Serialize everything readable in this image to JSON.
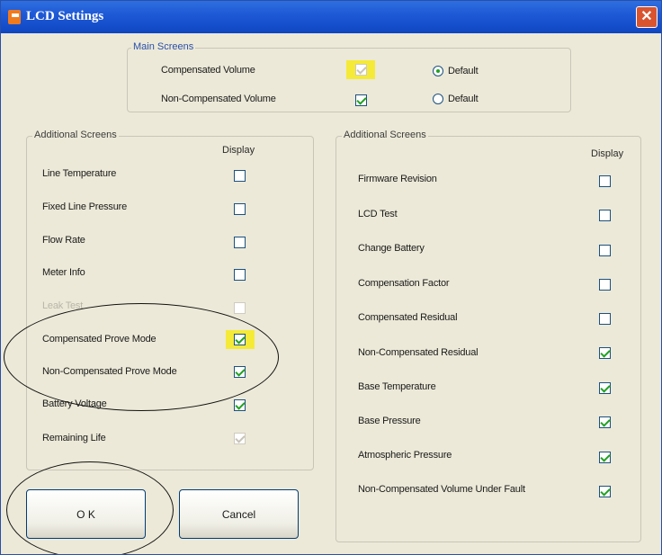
{
  "window": {
    "title": "LCD Settings",
    "close_glyph": "✕"
  },
  "main_screens": {
    "label": "Main Screens",
    "rows": [
      {
        "label": "Compensated Volume",
        "checked": true,
        "enabled": false,
        "highlight": true,
        "radio_label": "Default",
        "radio_selected": true
      },
      {
        "label": "Non-Compensated Volume",
        "checked": true,
        "enabled": true,
        "highlight": false,
        "radio_label": "Default",
        "radio_selected": false
      }
    ]
  },
  "additional_left": {
    "label": "Additional Screens",
    "display_header": "Display",
    "items": [
      {
        "label": "Line Temperature",
        "checked": false,
        "enabled": true
      },
      {
        "label": "Fixed Line Pressure",
        "checked": false,
        "enabled": true
      },
      {
        "label": "Flow Rate",
        "checked": false,
        "enabled": true
      },
      {
        "label": "Meter Info",
        "checked": false,
        "enabled": true
      },
      {
        "label": "Leak Test",
        "checked": false,
        "enabled": false
      },
      {
        "label": "Compensated Prove Mode",
        "checked": true,
        "enabled": true,
        "highlight": true
      },
      {
        "label": "Non-Compensated Prove Mode",
        "checked": true,
        "enabled": true
      },
      {
        "label": "Battery Voltage",
        "checked": true,
        "enabled": true
      },
      {
        "label": "Remaining Life",
        "checked": true,
        "enabled": false
      }
    ]
  },
  "additional_right": {
    "label": "Additional Screens",
    "display_header": "Display",
    "items": [
      {
        "label": "Firmware Revision",
        "checked": false
      },
      {
        "label": "LCD Test",
        "checked": false
      },
      {
        "label": "Change Battery",
        "checked": false
      },
      {
        "label": "Compensation Factor",
        "checked": false
      },
      {
        "label": "Compensated Residual",
        "checked": false
      },
      {
        "label": "Non-Compensated Residual",
        "checked": true
      },
      {
        "label": "Base Temperature",
        "checked": true
      },
      {
        "label": "Base Pressure",
        "checked": true
      },
      {
        "label": "Atmospheric Pressure",
        "checked": true
      },
      {
        "label": "Non-Compensated Volume Under Fault",
        "checked": true
      }
    ]
  },
  "buttons": {
    "ok_label": "O K",
    "cancel_label": "Cancel"
  }
}
